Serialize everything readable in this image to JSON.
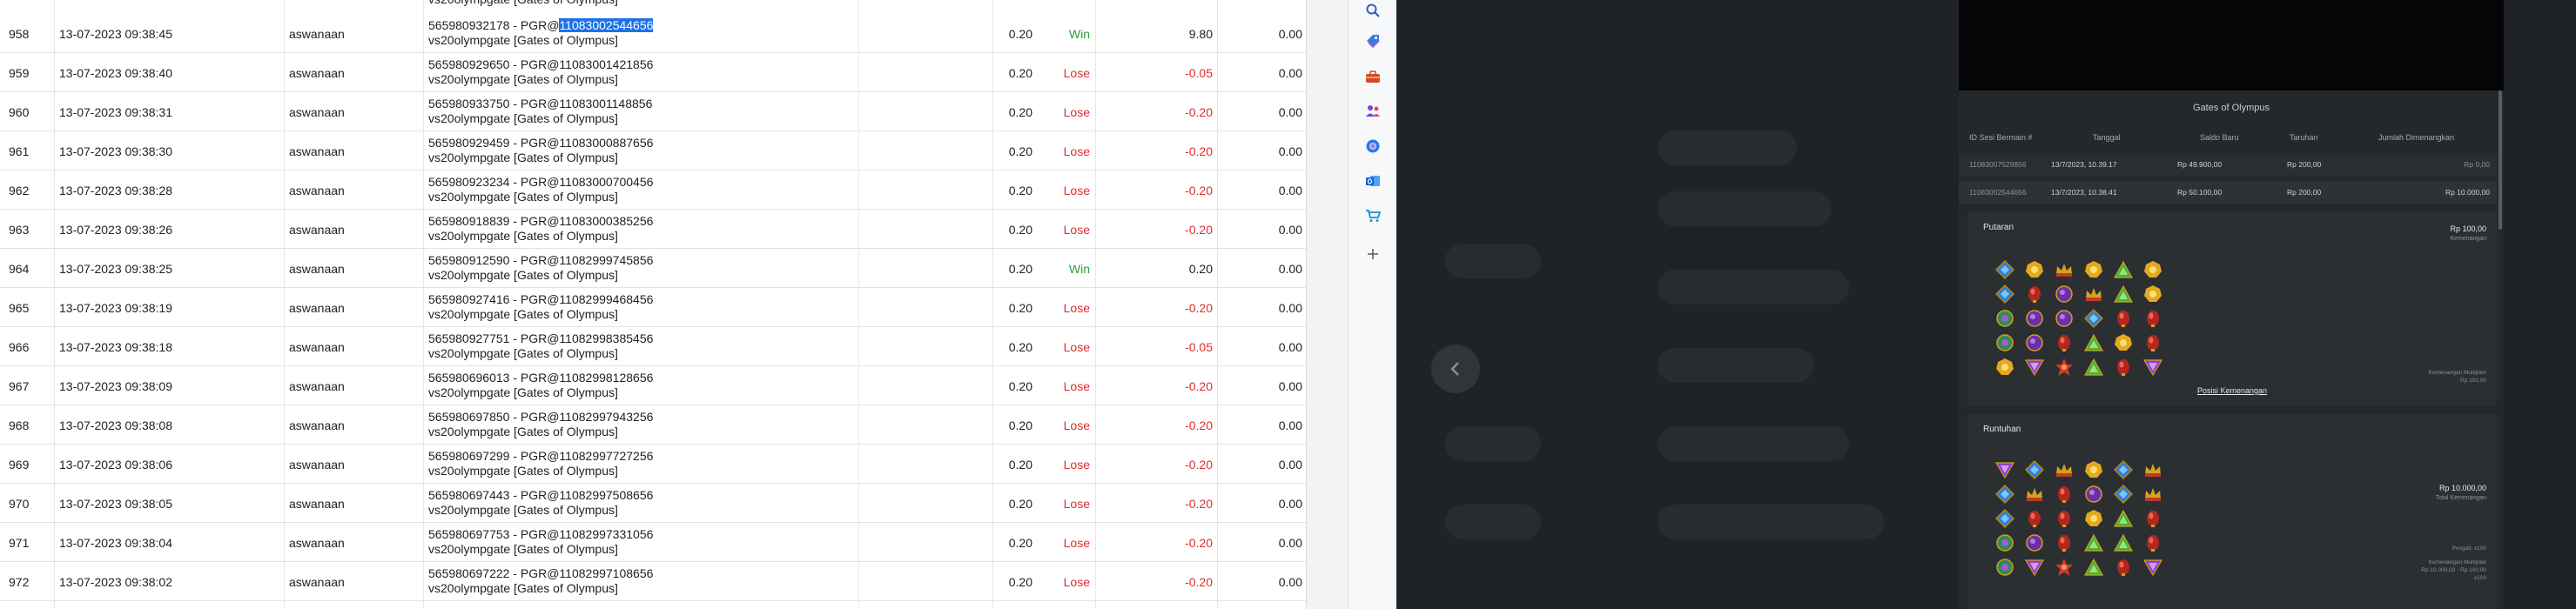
{
  "history": {
    "top_partial_desc": "vs20olympgate [Gates of Olympus]",
    "rows": [
      {
        "no": "958",
        "date": "13-07-2023 09:38:45",
        "user": "aswanaan",
        "desc_pre": "565980932178 - PGR@",
        "desc_sel": "11083002544656",
        "desc_post": "",
        "game": "vs20olympgate [Gates of Olympus]",
        "bet": "0.20",
        "result": "Win",
        "win": "9.80",
        "balance": "0.00"
      },
      {
        "no": "959",
        "date": "13-07-2023 09:38:40",
        "user": "aswanaan",
        "desc_pre": "565980929650 - PGR@11083001421856",
        "desc_sel": "",
        "desc_post": "",
        "game": "vs20olympgate [Gates of Olympus]",
        "bet": "0.20",
        "result": "Lose",
        "win": "-0.05",
        "balance": "0.00"
      },
      {
        "no": "960",
        "date": "13-07-2023 09:38:31",
        "user": "aswanaan",
        "desc_pre": "565980933750 - PGR@11083001148856",
        "desc_sel": "",
        "desc_post": "",
        "game": "vs20olympgate [Gates of Olympus]",
        "bet": "0.20",
        "result": "Lose",
        "win": "-0.20",
        "balance": "0.00"
      },
      {
        "no": "961",
        "date": "13-07-2023 09:38:30",
        "user": "aswanaan",
        "desc_pre": "565980929459 - PGR@11083000887656",
        "desc_sel": "",
        "desc_post": "",
        "game": "vs20olympgate [Gates of Olympus]",
        "bet": "0.20",
        "result": "Lose",
        "win": "-0.20",
        "balance": "0.00"
      },
      {
        "no": "962",
        "date": "13-07-2023 09:38:28",
        "user": "aswanaan",
        "desc_pre": "565980923234 - PGR@11083000700456",
        "desc_sel": "",
        "desc_post": "",
        "game": "vs20olympgate [Gates of Olympus]",
        "bet": "0.20",
        "result": "Lose",
        "win": "-0.20",
        "balance": "0.00"
      },
      {
        "no": "963",
        "date": "13-07-2023 09:38:26",
        "user": "aswanaan",
        "desc_pre": "565980918839 - PGR@11083000385256",
        "desc_sel": "",
        "desc_post": "",
        "game": "vs20olympgate [Gates of Olympus]",
        "bet": "0.20",
        "result": "Lose",
        "win": "-0.20",
        "balance": "0.00"
      },
      {
        "no": "964",
        "date": "13-07-2023 09:38:25",
        "user": "aswanaan",
        "desc_pre": "565980912590 - PGR@11082999745856",
        "desc_sel": "",
        "desc_post": "",
        "game": "vs20olympgate [Gates of Olympus]",
        "bet": "0.20",
        "result": "Win",
        "win": "0.20",
        "balance": "0.00"
      },
      {
        "no": "965",
        "date": "13-07-2023 09:38:19",
        "user": "aswanaan",
        "desc_pre": "565980927416 - PGR@11082999468456",
        "desc_sel": "",
        "desc_post": "",
        "game": "vs20olympgate [Gates of Olympus]",
        "bet": "0.20",
        "result": "Lose",
        "win": "-0.20",
        "balance": "0.00"
      },
      {
        "no": "966",
        "date": "13-07-2023 09:38:18",
        "user": "aswanaan",
        "desc_pre": "565980927751 - PGR@11082998385456",
        "desc_sel": "",
        "desc_post": "",
        "game": "vs20olympgate [Gates of Olympus]",
        "bet": "0.20",
        "result": "Lose",
        "win": "-0.05",
        "balance": "0.00"
      },
      {
        "no": "967",
        "date": "13-07-2023 09:38:09",
        "user": "aswanaan",
        "desc_pre": "565980696013 - PGR@11082998128656",
        "desc_sel": "",
        "desc_post": "",
        "game": "vs20olympgate [Gates of Olympus]",
        "bet": "0.20",
        "result": "Lose",
        "win": "-0.20",
        "balance": "0.00"
      },
      {
        "no": "968",
        "date": "13-07-2023 09:38:08",
        "user": "aswanaan",
        "desc_pre": "565980697850 - PGR@11082997943256",
        "desc_sel": "",
        "desc_post": "",
        "game": "vs20olympgate [Gates of Olympus]",
        "bet": "0.20",
        "result": "Lose",
        "win": "-0.20",
        "balance": "0.00"
      },
      {
        "no": "969",
        "date": "13-07-2023 09:38:06",
        "user": "aswanaan",
        "desc_pre": "565980697299 - PGR@11082997727256",
        "desc_sel": "",
        "desc_post": "",
        "game": "vs20olympgate [Gates of Olympus]",
        "bet": "0.20",
        "result": "Lose",
        "win": "-0.20",
        "balance": "0.00"
      },
      {
        "no": "970",
        "date": "13-07-2023 09:38:05",
        "user": "aswanaan",
        "desc_pre": "565980697443 - PGR@11082997508656",
        "desc_sel": "",
        "desc_post": "",
        "game": "vs20olympgate [Gates of Olympus]",
        "bet": "0.20",
        "result": "Lose",
        "win": "-0.20",
        "balance": "0.00"
      },
      {
        "no": "971",
        "date": "13-07-2023 09:38:04",
        "user": "aswanaan",
        "desc_pre": "565980697753 - PGR@11082997331056",
        "desc_sel": "",
        "desc_post": "",
        "game": "vs20olympgate [Gates of Olympus]",
        "bet": "0.20",
        "result": "Lose",
        "win": "-0.20",
        "balance": "0.00"
      },
      {
        "no": "972",
        "date": "13-07-2023 09:38:02",
        "user": "aswanaan",
        "desc_pre": "565980697222 - PGR@11082997108656",
        "desc_sel": "",
        "desc_post": "",
        "game": "vs20olympgate [Gates of Olympus]",
        "bet": "0.20",
        "result": "Lose",
        "win": "-0.20",
        "balance": "0.00"
      }
    ]
  },
  "colors": {
    "win": "#2e9d3a",
    "lose": "#e02c2c",
    "selection": "#1a73e8",
    "game_bg": "#1f2327",
    "modal_bg": "#25282b"
  },
  "side_bar": {
    "icons": [
      "search-icon",
      "tag-icon",
      "toolbox-icon",
      "people-icon",
      "copilot-icon",
      "outlook-icon",
      "shopping-cart-icon",
      "add-icon"
    ]
  },
  "game_modal": {
    "title": "Gates of Olympus",
    "headers": {
      "id": "ID Sesi Bermain #",
      "date": "Tanggal",
      "balance": "Saldo Baru",
      "bet": "Taruhan",
      "win": "Jumlah Dimenangkan"
    },
    "rows": [
      {
        "id": "11083007529856",
        "date": "13/7/2023, 10.39.17",
        "balance": "Rp 49.900,00",
        "bet": "Rp 200,00",
        "win": "Rp 0,00"
      },
      {
        "id": "11083002544656",
        "date": "13/7/2023, 10.38.41",
        "balance": "Rp 50.100,00",
        "bet": "Rp 200,00",
        "win": "Rp 10.000,00"
      }
    ],
    "spin": {
      "title": "Putaran",
      "amount": "Rp 100,00",
      "amount_sub": "Kemenangan",
      "note": "Kemenangan Multiplier\nRp 100,00",
      "link": "Posisi Kemenangan",
      "grid": [
        [
          "blue-diamond",
          "gold-ring",
          "red-crown",
          "gold-ring",
          "green-triangle",
          "gold-ring"
        ],
        [
          "blue-diamond",
          "red-chalice",
          "purple-orb",
          "red-crown",
          "green-triangle",
          "gold-ring"
        ],
        [
          "green-orb",
          "purple-orb",
          "purple-orb",
          "blue-diamond",
          "red-chalice",
          "red-chalice"
        ],
        [
          "green-orb",
          "purple-orb",
          "red-chalice",
          "green-triangle",
          "gold-ring",
          "red-chalice"
        ],
        [
          "gold-ring",
          "purple-triangle",
          "red-star",
          "green-triangle",
          "red-chalice",
          "purple-triangle"
        ]
      ]
    },
    "tumble": {
      "title": "Runtuhan",
      "amount": "Rp 10.000,00",
      "amount_sub": "Total Kemenangan",
      "note1": "Pengali: x100",
      "note2": "Kemenangan Multiplier\nRp 10.000,00 · Rp 100,00\nx100",
      "grid": [
        [
          "purple-triangle",
          "blue-diamond",
          "red-crown",
          "gold-ring",
          "blue-diamond",
          "red-crown"
        ],
        [
          "blue-diamond",
          "red-crown",
          "red-chalice",
          "purple-orb",
          "blue-diamond",
          "red-crown"
        ],
        [
          "blue-diamond",
          "red-chalice",
          "red-chalice",
          "gold-ring",
          "green-triangle",
          "red-chalice"
        ],
        [
          "green-orb",
          "purple-orb",
          "red-chalice",
          "green-triangle",
          "green-triangle",
          "red-chalice"
        ],
        [
          "green-orb",
          "purple-triangle",
          "red-star",
          "green-triangle",
          "red-chalice",
          "purple-triangle"
        ]
      ]
    }
  }
}
